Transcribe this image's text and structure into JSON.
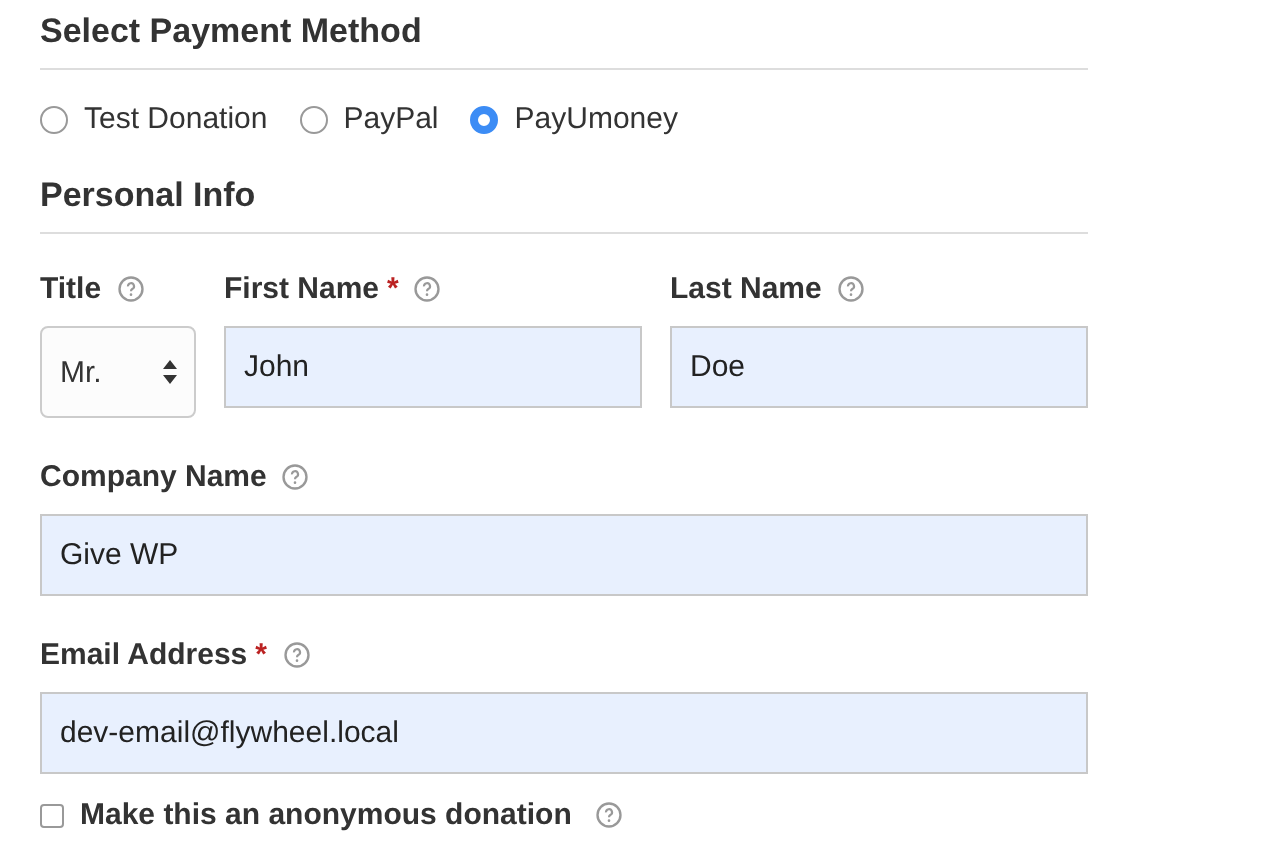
{
  "payment": {
    "heading": "Select Payment Method",
    "options": [
      {
        "label": "Test Donation",
        "selected": false
      },
      {
        "label": "PayPal",
        "selected": false
      },
      {
        "label": "PayUmoney",
        "selected": true
      }
    ]
  },
  "personal": {
    "heading": "Personal Info",
    "title_field": {
      "label": "Title",
      "value": "Mr."
    },
    "name_fields": [
      {
        "label": "First Name",
        "required_mark": "*",
        "value": "John"
      },
      {
        "label": "Last Name",
        "value": "Doe"
      }
    ],
    "wide_fields": [
      {
        "label": "Company Name",
        "value": "Give WP"
      },
      {
        "label": "Email Address",
        "required_mark": "*",
        "value": "dev-email@flywheel.local"
      }
    ],
    "anonymous": {
      "label": "Make this an anonymous donation",
      "checked": false
    }
  }
}
